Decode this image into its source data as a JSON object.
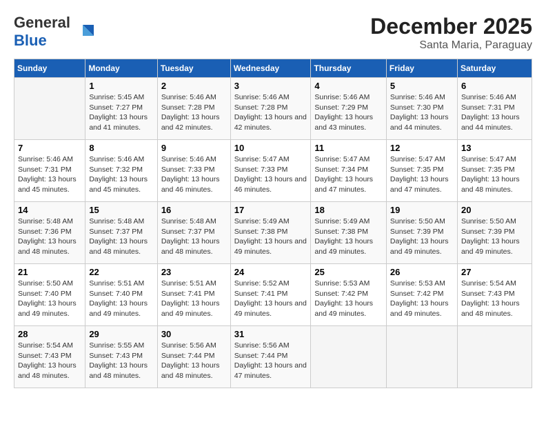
{
  "header": {
    "logo_general": "General",
    "logo_blue": "Blue",
    "month_title": "December 2025",
    "subtitle": "Santa Maria, Paraguay"
  },
  "weekdays": [
    "Sunday",
    "Monday",
    "Tuesday",
    "Wednesday",
    "Thursday",
    "Friday",
    "Saturday"
  ],
  "weeks": [
    [
      {
        "day": "",
        "empty": true
      },
      {
        "day": "1",
        "sunrise": "Sunrise: 5:45 AM",
        "sunset": "Sunset: 7:27 PM",
        "daylight": "Daylight: 13 hours and 41 minutes."
      },
      {
        "day": "2",
        "sunrise": "Sunrise: 5:46 AM",
        "sunset": "Sunset: 7:28 PM",
        "daylight": "Daylight: 13 hours and 42 minutes."
      },
      {
        "day": "3",
        "sunrise": "Sunrise: 5:46 AM",
        "sunset": "Sunset: 7:28 PM",
        "daylight": "Daylight: 13 hours and 42 minutes."
      },
      {
        "day": "4",
        "sunrise": "Sunrise: 5:46 AM",
        "sunset": "Sunset: 7:29 PM",
        "daylight": "Daylight: 13 hours and 43 minutes."
      },
      {
        "day": "5",
        "sunrise": "Sunrise: 5:46 AM",
        "sunset": "Sunset: 7:30 PM",
        "daylight": "Daylight: 13 hours and 44 minutes."
      },
      {
        "day": "6",
        "sunrise": "Sunrise: 5:46 AM",
        "sunset": "Sunset: 7:31 PM",
        "daylight": "Daylight: 13 hours and 44 minutes."
      }
    ],
    [
      {
        "day": "7",
        "sunrise": "Sunrise: 5:46 AM",
        "sunset": "Sunset: 7:31 PM",
        "daylight": "Daylight: 13 hours and 45 minutes."
      },
      {
        "day": "8",
        "sunrise": "Sunrise: 5:46 AM",
        "sunset": "Sunset: 7:32 PM",
        "daylight": "Daylight: 13 hours and 45 minutes."
      },
      {
        "day": "9",
        "sunrise": "Sunrise: 5:46 AM",
        "sunset": "Sunset: 7:33 PM",
        "daylight": "Daylight: 13 hours and 46 minutes."
      },
      {
        "day": "10",
        "sunrise": "Sunrise: 5:47 AM",
        "sunset": "Sunset: 7:33 PM",
        "daylight": "Daylight: 13 hours and 46 minutes."
      },
      {
        "day": "11",
        "sunrise": "Sunrise: 5:47 AM",
        "sunset": "Sunset: 7:34 PM",
        "daylight": "Daylight: 13 hours and 47 minutes."
      },
      {
        "day": "12",
        "sunrise": "Sunrise: 5:47 AM",
        "sunset": "Sunset: 7:35 PM",
        "daylight": "Daylight: 13 hours and 47 minutes."
      },
      {
        "day": "13",
        "sunrise": "Sunrise: 5:47 AM",
        "sunset": "Sunset: 7:35 PM",
        "daylight": "Daylight: 13 hours and 48 minutes."
      }
    ],
    [
      {
        "day": "14",
        "sunrise": "Sunrise: 5:48 AM",
        "sunset": "Sunset: 7:36 PM",
        "daylight": "Daylight: 13 hours and 48 minutes."
      },
      {
        "day": "15",
        "sunrise": "Sunrise: 5:48 AM",
        "sunset": "Sunset: 7:37 PM",
        "daylight": "Daylight: 13 hours and 48 minutes."
      },
      {
        "day": "16",
        "sunrise": "Sunrise: 5:48 AM",
        "sunset": "Sunset: 7:37 PM",
        "daylight": "Daylight: 13 hours and 48 minutes."
      },
      {
        "day": "17",
        "sunrise": "Sunrise: 5:49 AM",
        "sunset": "Sunset: 7:38 PM",
        "daylight": "Daylight: 13 hours and 49 minutes."
      },
      {
        "day": "18",
        "sunrise": "Sunrise: 5:49 AM",
        "sunset": "Sunset: 7:38 PM",
        "daylight": "Daylight: 13 hours and 49 minutes."
      },
      {
        "day": "19",
        "sunrise": "Sunrise: 5:50 AM",
        "sunset": "Sunset: 7:39 PM",
        "daylight": "Daylight: 13 hours and 49 minutes."
      },
      {
        "day": "20",
        "sunrise": "Sunrise: 5:50 AM",
        "sunset": "Sunset: 7:39 PM",
        "daylight": "Daylight: 13 hours and 49 minutes."
      }
    ],
    [
      {
        "day": "21",
        "sunrise": "Sunrise: 5:50 AM",
        "sunset": "Sunset: 7:40 PM",
        "daylight": "Daylight: 13 hours and 49 minutes."
      },
      {
        "day": "22",
        "sunrise": "Sunrise: 5:51 AM",
        "sunset": "Sunset: 7:40 PM",
        "daylight": "Daylight: 13 hours and 49 minutes."
      },
      {
        "day": "23",
        "sunrise": "Sunrise: 5:51 AM",
        "sunset": "Sunset: 7:41 PM",
        "daylight": "Daylight: 13 hours and 49 minutes."
      },
      {
        "day": "24",
        "sunrise": "Sunrise: 5:52 AM",
        "sunset": "Sunset: 7:41 PM",
        "daylight": "Daylight: 13 hours and 49 minutes."
      },
      {
        "day": "25",
        "sunrise": "Sunrise: 5:53 AM",
        "sunset": "Sunset: 7:42 PM",
        "daylight": "Daylight: 13 hours and 49 minutes."
      },
      {
        "day": "26",
        "sunrise": "Sunrise: 5:53 AM",
        "sunset": "Sunset: 7:42 PM",
        "daylight": "Daylight: 13 hours and 49 minutes."
      },
      {
        "day": "27",
        "sunrise": "Sunrise: 5:54 AM",
        "sunset": "Sunset: 7:43 PM",
        "daylight": "Daylight: 13 hours and 48 minutes."
      }
    ],
    [
      {
        "day": "28",
        "sunrise": "Sunrise: 5:54 AM",
        "sunset": "Sunset: 7:43 PM",
        "daylight": "Daylight: 13 hours and 48 minutes."
      },
      {
        "day": "29",
        "sunrise": "Sunrise: 5:55 AM",
        "sunset": "Sunset: 7:43 PM",
        "daylight": "Daylight: 13 hours and 48 minutes."
      },
      {
        "day": "30",
        "sunrise": "Sunrise: 5:56 AM",
        "sunset": "Sunset: 7:44 PM",
        "daylight": "Daylight: 13 hours and 48 minutes."
      },
      {
        "day": "31",
        "sunrise": "Sunrise: 5:56 AM",
        "sunset": "Sunset: 7:44 PM",
        "daylight": "Daylight: 13 hours and 47 minutes."
      },
      {
        "day": "",
        "empty": true
      },
      {
        "day": "",
        "empty": true
      },
      {
        "day": "",
        "empty": true
      }
    ]
  ]
}
